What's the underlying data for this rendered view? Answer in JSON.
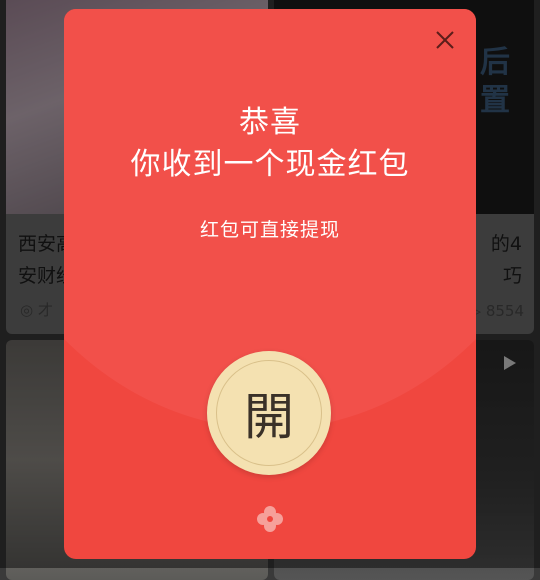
{
  "feed": {
    "left_card": {
      "title_line1": "西安高",
      "title_line2": "安财经",
      "meta": "才"
    },
    "right_card": {
      "title_line1": "的4",
      "title_line2": "巧",
      "views": "8554",
      "overlay_text": "后置"
    }
  },
  "packet": {
    "congrats": "恭喜",
    "headline": "你收到一个现金红包",
    "subtitle": "红包可直接提现",
    "open_label": "開"
  },
  "colors": {
    "packet_red": "#f0473f",
    "button_gold": "#f4e1b1",
    "logo_pink": "#f6a09a"
  }
}
